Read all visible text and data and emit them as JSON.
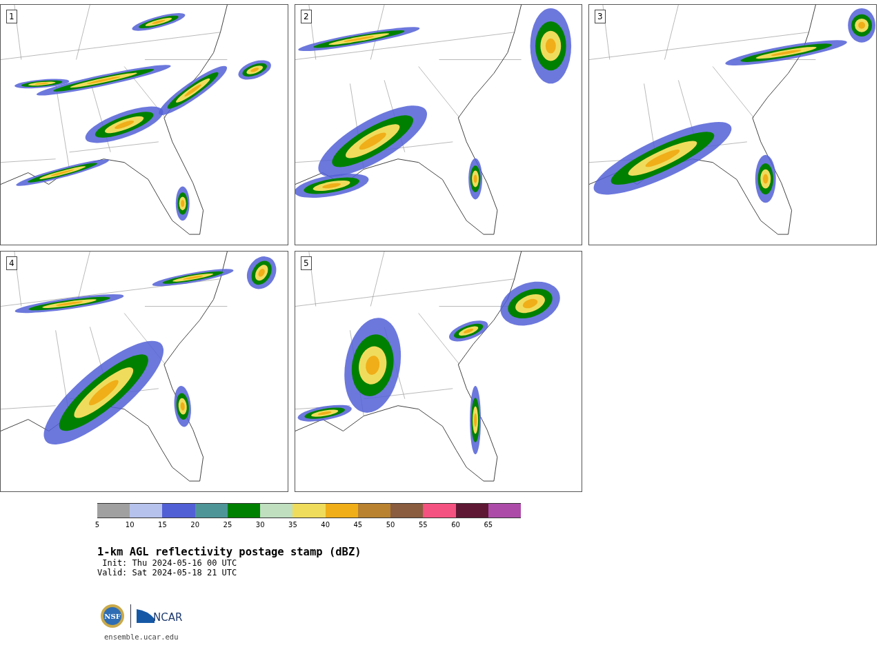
{
  "panels": [
    {
      "number": "1"
    },
    {
      "number": "2"
    },
    {
      "number": "3"
    },
    {
      "number": "4"
    },
    {
      "number": "5"
    }
  ],
  "colorbar": [
    {
      "label": "5",
      "color": "#a0a0a0"
    },
    {
      "label": "10",
      "color": "#b6c2ec"
    },
    {
      "label": "15",
      "color": "#5260d6"
    },
    {
      "label": "20",
      "color": "#4e9598"
    },
    {
      "label": "25",
      "color": "#008000"
    },
    {
      "label": "30",
      "color": "#bfdfbf"
    },
    {
      "label": "35",
      "color": "#f0dc5c"
    },
    {
      "label": "40",
      "color": "#f0ae18"
    },
    {
      "label": "45",
      "color": "#b88230"
    },
    {
      "label": "50",
      "color": "#8a5c40"
    },
    {
      "label": "55",
      "color": "#f45280"
    },
    {
      "label": "60",
      "color": "#5e1834"
    },
    {
      "label": "65",
      "color": "#ac4ca8"
    }
  ],
  "title": "1-km AGL reflectivity postage stamp (dBZ)",
  "init": " Init: Thu 2024-05-16 00 UTC",
  "valid": "Valid: Sat 2024-05-18 21 UTC",
  "logo": {
    "nsf": "NSF",
    "ncar": "NCAR"
  },
  "url": "ensemble.ucar.edu"
}
